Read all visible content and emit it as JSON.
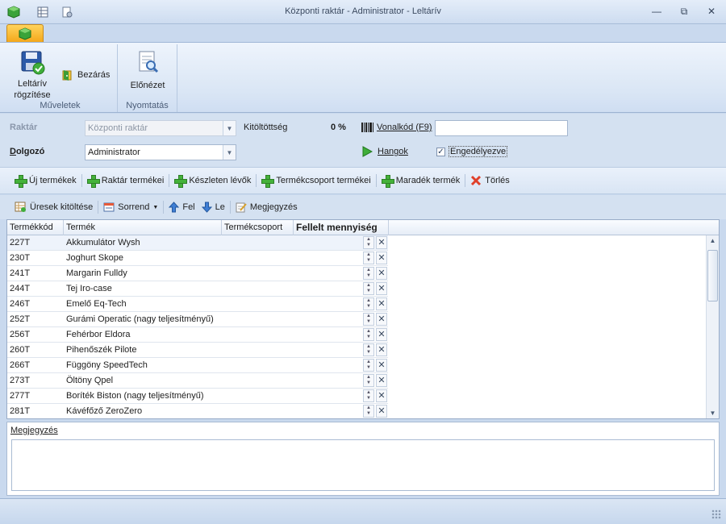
{
  "window": {
    "title": "Központi raktár - Administrator - Leltárív",
    "controls": {
      "minimize": "—",
      "restore": "⧉",
      "close": "✕"
    }
  },
  "ribbon": {
    "groups": [
      {
        "caption": "Műveletek",
        "buttons": [
          {
            "label_line1": "Leltárív",
            "label_line2": "rögzítése",
            "icon": "save-check-icon"
          },
          {
            "label": "Bezárás",
            "icon": "close-door-icon"
          }
        ]
      },
      {
        "caption": "Nyomtatás",
        "buttons": [
          {
            "label": "Előnézet",
            "icon": "print-preview-icon"
          }
        ]
      }
    ]
  },
  "form": {
    "raktar_label": "Raktár",
    "raktar_value": "Központi raktár",
    "dolgozo_label": "Dolgozó",
    "dolgozo_value": "Administrator",
    "kitoltottseg_label": "Kitöltöttség",
    "kitoltottseg_value": "0 %",
    "vonalkod_label": "Vonalkód (F9)",
    "vonalkod_value": "",
    "hangok_label": "Hangok",
    "engedelyezve_label": "Engedélyezve",
    "engedelyezve_checked": true
  },
  "toolbar1": [
    {
      "label": "Új termékek",
      "icon": "plus-icon"
    },
    {
      "label": "Raktár termékei",
      "icon": "plus-icon"
    },
    {
      "label": "Készleten lévők",
      "icon": "plus-icon"
    },
    {
      "label": "Termékcsoport termékei",
      "icon": "plus-icon"
    },
    {
      "label": "Maradék termék",
      "icon": "plus-icon"
    },
    {
      "label": "Törlés",
      "icon": "delete-x-icon"
    }
  ],
  "toolbar2": [
    {
      "label": "Üresek kitöltése",
      "icon": "fill-grid-icon"
    },
    {
      "label": "Sorrend",
      "icon": "order-icon"
    },
    {
      "label": "Fel",
      "icon": "arrow-up-icon"
    },
    {
      "label": "Le",
      "icon": "arrow-down-icon"
    },
    {
      "label": "Megjegyzés",
      "icon": "note-edit-icon"
    }
  ],
  "grid": {
    "columns": [
      "Termékkód",
      "Termék",
      "Termékcsoport",
      "Fellelt mennyiség"
    ],
    "rows": [
      {
        "code": "227T",
        "name": "Akkumulátor Wysh"
      },
      {
        "code": "230T",
        "name": "Joghurt Skope"
      },
      {
        "code": "241T",
        "name": "Margarin Fulldy"
      },
      {
        "code": "244T",
        "name": "Tej Iro-case"
      },
      {
        "code": "246T",
        "name": "Emelő Eq-Tech"
      },
      {
        "code": "252T",
        "name": "Gurámi Operatic (nagy teljesítményű)"
      },
      {
        "code": "256T",
        "name": "Fehérbor Eldora"
      },
      {
        "code": "260T",
        "name": "Pihenőszék Pilote"
      },
      {
        "code": "266T",
        "name": "Függöny SpeedTech"
      },
      {
        "code": "273T",
        "name": "Öltöny Qpel"
      },
      {
        "code": "277T",
        "name": "Boríték Biston (nagy teljesítményű)"
      },
      {
        "code": "281T",
        "name": "Kávéfőző ZeroZero"
      }
    ]
  },
  "note": {
    "label": "Megjegyzés",
    "value": ""
  },
  "colors": {
    "accent": "#f4a81b",
    "ribbon": "#dae6f5",
    "green": "#44b23a",
    "red": "#e0402a"
  }
}
